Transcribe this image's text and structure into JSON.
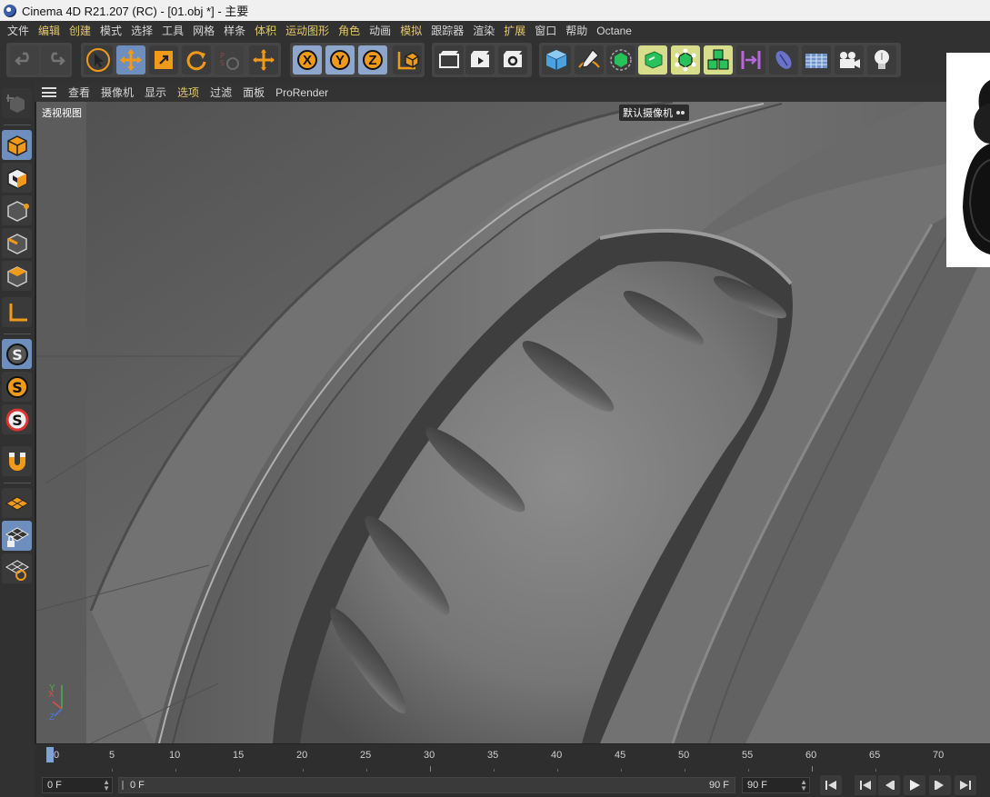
{
  "window": {
    "title": "Cinema 4D R21.207 (RC) - [01.obj *] - 主要"
  },
  "menubar": {
    "items": [
      "文件",
      "编辑",
      "创建",
      "模式",
      "选择",
      "工具",
      "网格",
      "样条",
      "体积",
      "运动图形",
      "角色",
      "动画",
      "模拟",
      "跟踪器",
      "渲染",
      "扩展",
      "窗口",
      "帮助",
      "Octane"
    ]
  },
  "toolbar": {
    "axis_x": "X",
    "axis_y": "Y",
    "axis_z": "Z",
    "icons": [
      "undo-icon",
      "redo-icon",
      "select-arrow-icon",
      "move-icon",
      "scale-icon",
      "rotate-icon",
      "psr-icon",
      "snap-move-icon",
      "axis-x-icon",
      "axis-y-icon",
      "axis-z-icon",
      "coord-system-icon",
      "render-region-icon",
      "render-view-icon",
      "render-settings-icon",
      "cube-icon",
      "pen-icon",
      "subdivision-icon",
      "extrude-icon",
      "cloner-icon",
      "mograph-icon",
      "deformer-icon",
      "sculpt-icon",
      "floor-icon",
      "camera-icon",
      "light-icon"
    ]
  },
  "viewport_menu": {
    "items": [
      "查看",
      "摄像机",
      "显示",
      "选项",
      "过滤",
      "面板",
      "ProRender"
    ]
  },
  "viewport": {
    "label": "透视视图",
    "camera": "默认摄像机",
    "axis_labels": {
      "x": "X",
      "y": "Y",
      "z": "Z"
    }
  },
  "timeline": {
    "ticks": [
      "0",
      "5",
      "10",
      "15",
      "20",
      "25",
      "30",
      "35",
      "40",
      "45",
      "50",
      "55",
      "60",
      "65",
      "70"
    ]
  },
  "transport": {
    "current_frame": "0 F",
    "range_start": "0 F",
    "range_end": "90 F",
    "max_frame": "90 F"
  },
  "colors": {
    "accent_blue": "#6e8ebd",
    "menu_yellow": "#e6c86a",
    "icon_orange": "#f09a1a"
  }
}
